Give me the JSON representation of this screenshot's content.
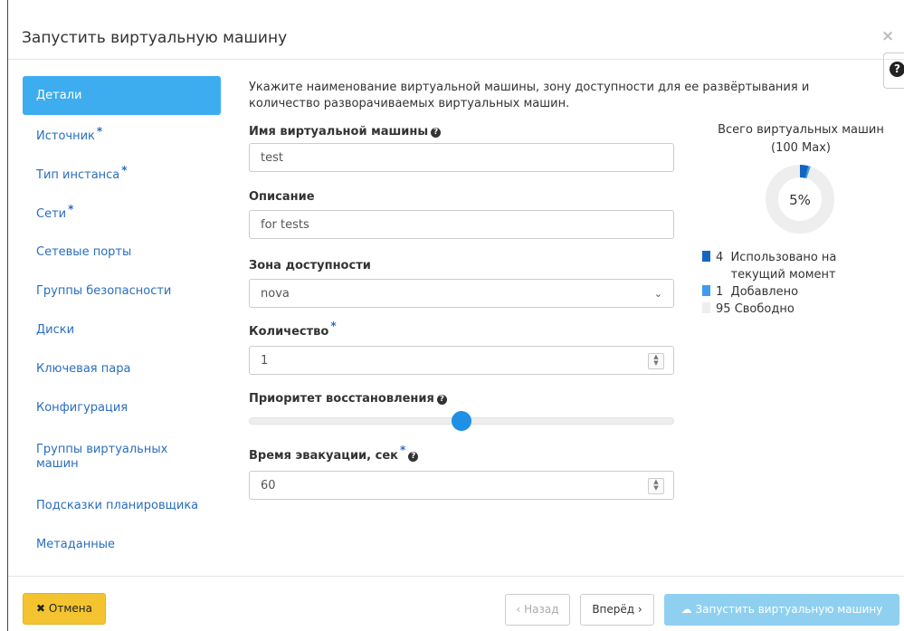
{
  "modal": {
    "title": "Запустить виртуальную машину",
    "close_icon": "×",
    "help_icon": "?"
  },
  "sidebar": {
    "items": [
      {
        "label": "Детали",
        "active": true,
        "required": false
      },
      {
        "label": "Источник",
        "active": false,
        "required": true
      },
      {
        "label": "Тип инстанса",
        "active": false,
        "required": true
      },
      {
        "label": "Сети",
        "active": false,
        "required": true
      },
      {
        "label": "Сетевые порты",
        "active": false,
        "required": false
      },
      {
        "label": "Группы безопасности",
        "active": false,
        "required": false
      },
      {
        "label": "Диски",
        "active": false,
        "required": false
      },
      {
        "label": "Ключевая пара",
        "active": false,
        "required": false
      },
      {
        "label": "Конфигурация",
        "active": false,
        "required": false
      },
      {
        "label": "Группы виртуальных машин",
        "active": false,
        "required": false
      },
      {
        "label": "Подсказки планировщика",
        "active": false,
        "required": false
      },
      {
        "label": "Метаданные",
        "active": false,
        "required": false
      }
    ]
  },
  "form": {
    "intro": "Укажите наименование виртуальной машины, зону доступности для ее развёртывания и количество разворачиваемых виртуальных машин.",
    "name_label": "Имя виртуальной машины",
    "name_value": "test",
    "description_label": "Описание",
    "description_value": "for tests",
    "zone_label": "Зона доступности",
    "zone_value": "nova",
    "count_label": "Количество",
    "count_value": "1",
    "priority_label": "Приоритет восстановления",
    "priority_level": 0.5,
    "evac_label": "Время эвакуации, сек",
    "evac_value": "60"
  },
  "quota": {
    "title_line1": "Всего виртуальных машин",
    "title_line2": "(100 Max)",
    "percent": "5%",
    "used_value": "4",
    "used_label": "Использовано на текущий момент",
    "added_value": "1",
    "added_label": "Добавлено",
    "free_value": "95",
    "free_label": "Свободно",
    "colors": {
      "used": "#1565c0",
      "added": "#3d9cf0",
      "free": "#eeeeee"
    }
  },
  "footer": {
    "cancel_label": "Отмена",
    "back_label": "‹ Назад",
    "next_label": "Вперёд ›",
    "launch_label": "Запустить виртуальную машину"
  }
}
